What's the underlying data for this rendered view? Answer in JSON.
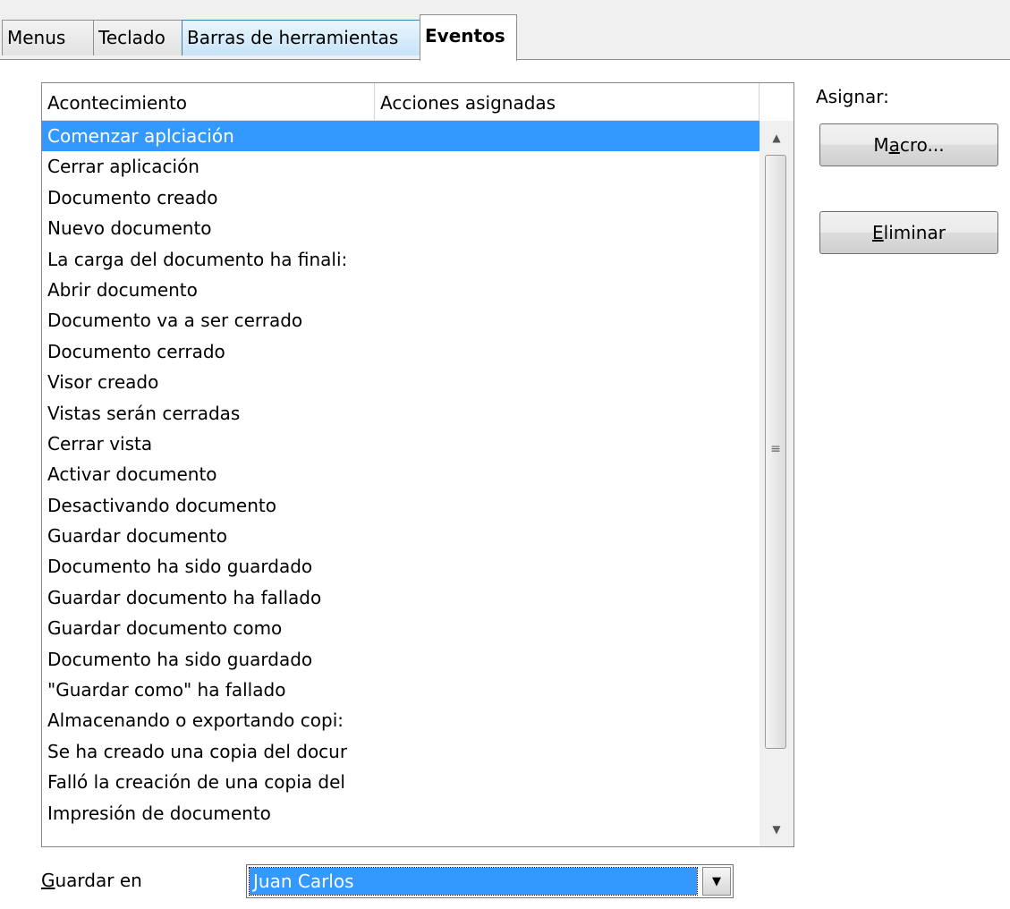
{
  "tabs": [
    {
      "label": "Menus"
    },
    {
      "label": "Teclado"
    },
    {
      "label": "Barras de herramientas"
    },
    {
      "label": "Eventos"
    }
  ],
  "active_tab": "Eventos",
  "list": {
    "columns": [
      "Acontecimiento",
      "Acciones asignadas"
    ],
    "selected_index": 0,
    "rows": [
      {
        "event": "Comenzar aplciación",
        "action": ""
      },
      {
        "event": "Cerrar aplicación",
        "action": ""
      },
      {
        "event": "Documento creado",
        "action": ""
      },
      {
        "event": "Nuevo documento",
        "action": ""
      },
      {
        "event": "La carga del documento ha finali:",
        "action": ""
      },
      {
        "event": "Abrir documento",
        "action": ""
      },
      {
        "event": "Documento va a ser cerrado",
        "action": ""
      },
      {
        "event": "Documento cerrado",
        "action": ""
      },
      {
        "event": "Visor creado",
        "action": ""
      },
      {
        "event": "Vistas serán cerradas",
        "action": ""
      },
      {
        "event": "Cerrar vista",
        "action": ""
      },
      {
        "event": "Activar documento",
        "action": ""
      },
      {
        "event": "Desactivando documento",
        "action": ""
      },
      {
        "event": "Guardar documento",
        "action": ""
      },
      {
        "event": "Documento ha sido guardado",
        "action": ""
      },
      {
        "event": "Guardar documento ha fallado",
        "action": ""
      },
      {
        "event": "Guardar documento como",
        "action": ""
      },
      {
        "event": "Documento ha sido guardado",
        "action": ""
      },
      {
        "event": "\"Guardar como\" ha fallado",
        "action": ""
      },
      {
        "event": "Almacenando o exportando copi:",
        "action": ""
      },
      {
        "event": "Se ha creado una copia del docur",
        "action": ""
      },
      {
        "event": "Falló la creación de una copia del",
        "action": ""
      },
      {
        "event": "Impresión de documento",
        "action": ""
      }
    ]
  },
  "assign": {
    "label": "Asignar:",
    "macro_prefix": "M",
    "macro_access": "a",
    "macro_suffix": "cro...",
    "delete_access": "E",
    "delete_suffix": "liminar"
  },
  "save_in": {
    "label_access": "G",
    "label_suffix": "uardar en",
    "value": "Juan Carlos"
  },
  "icons": {
    "scroll_up": "triangle-up-icon",
    "scroll_down": "triangle-down-icon",
    "grip": "scroll-grip-icon",
    "combo_arrow": "chevron-down-icon"
  },
  "colors": {
    "selection": "#3399ff",
    "tab_hover": "#c7e4f8"
  }
}
